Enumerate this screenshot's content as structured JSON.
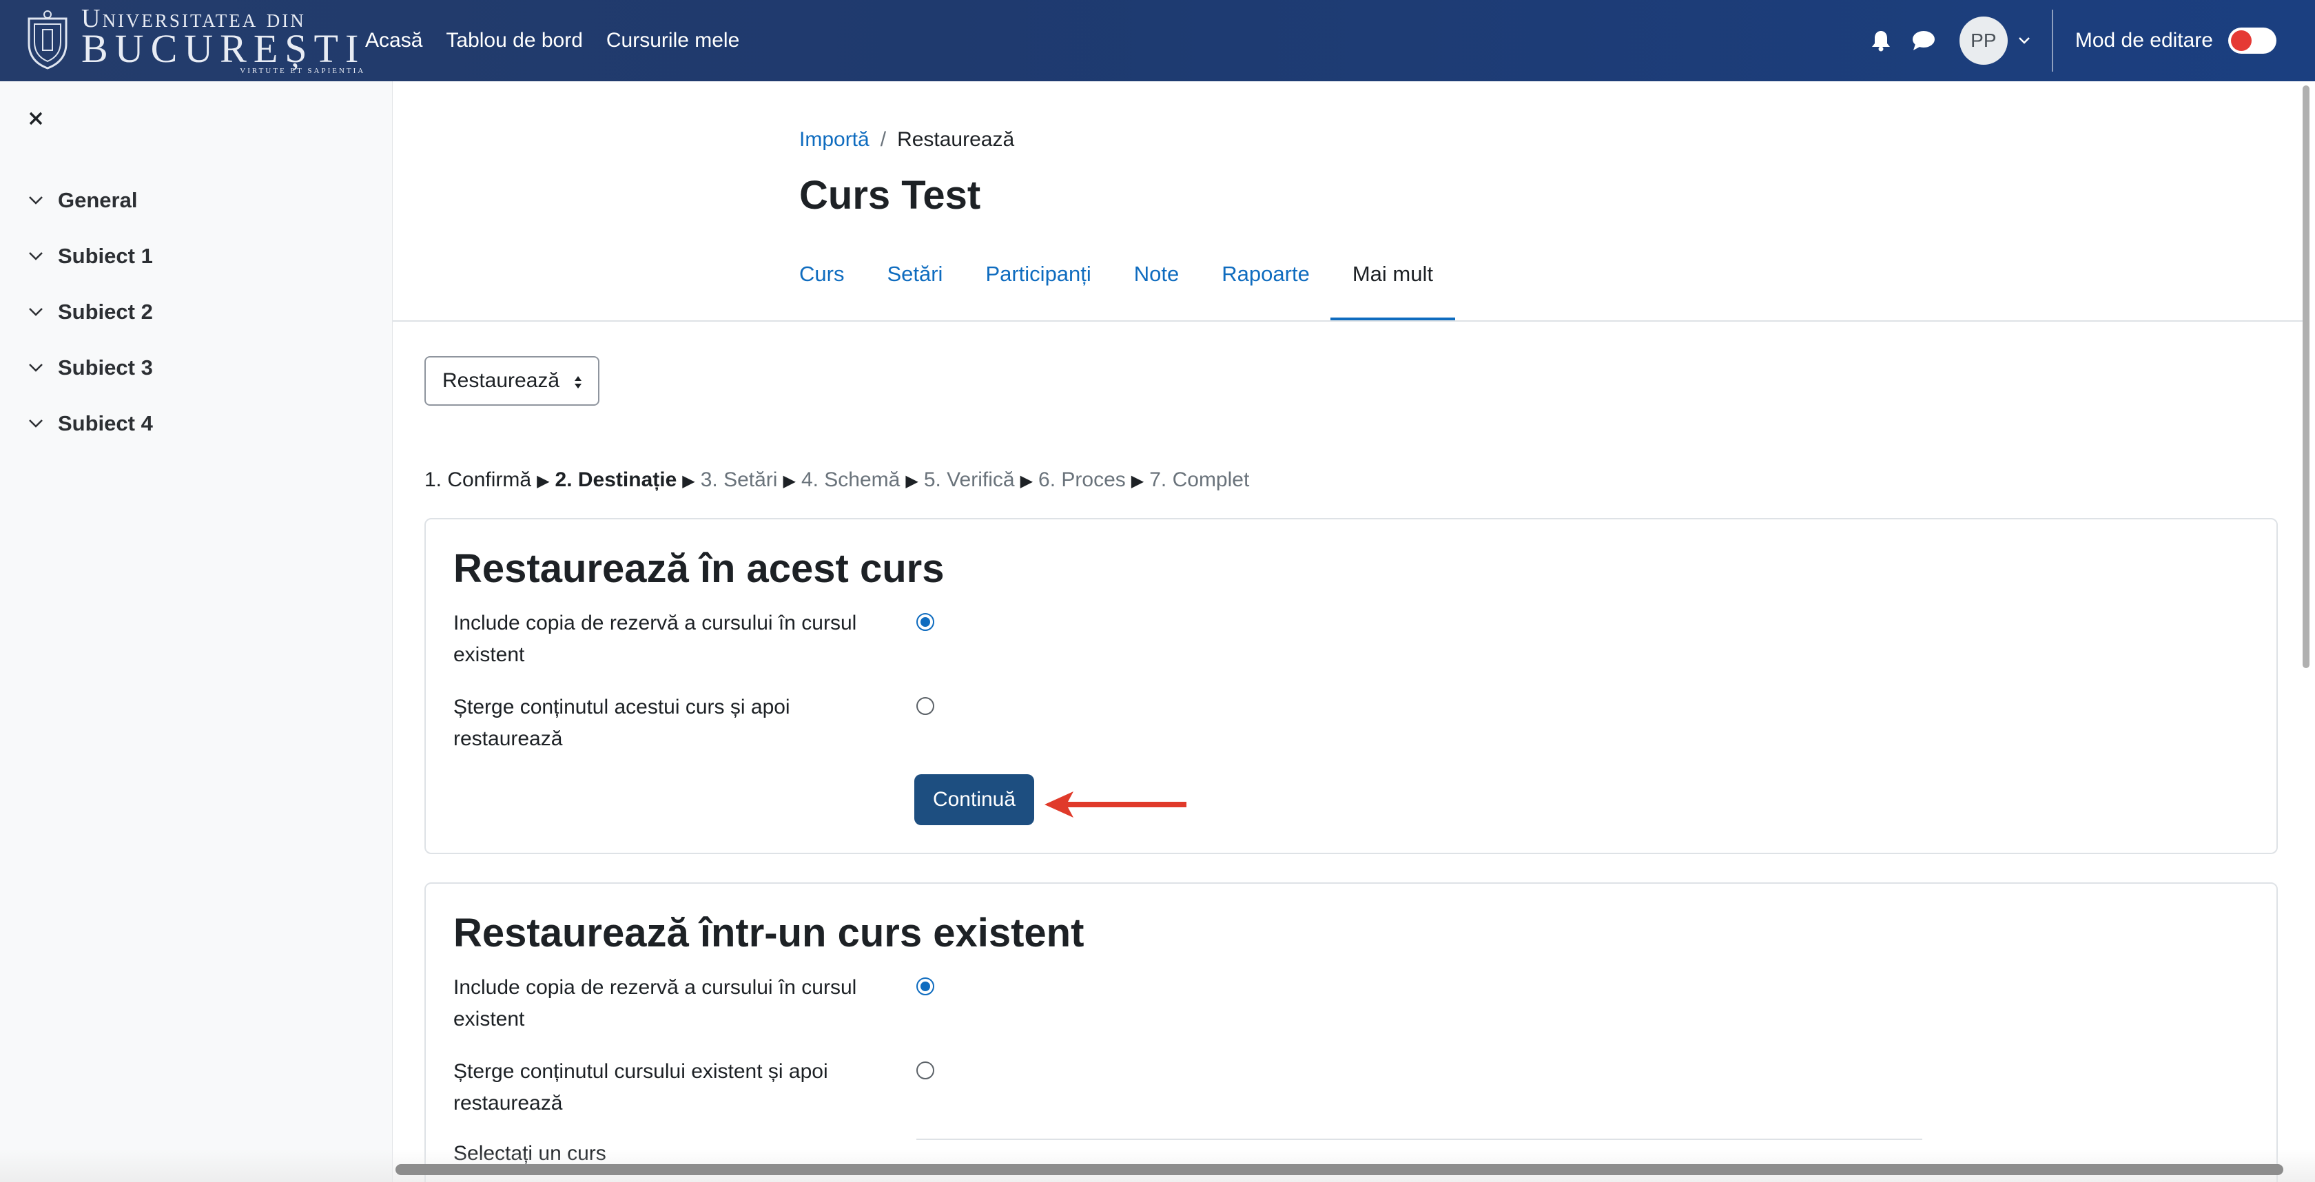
{
  "navbar": {
    "logo": {
      "line1": "Universitatea din",
      "line2": "BUCUREȘTI",
      "line3": "VIRTUTE ET SAPIENTIA"
    },
    "links": [
      "Acasă",
      "Tablou de bord",
      "Cursurile mele"
    ],
    "notifications_icon": "bell-icon",
    "messages_icon": "chat-bubble-icon",
    "user_initials": "PP",
    "edit_mode_label": "Mod de editare",
    "edit_mode_on": false
  },
  "drawer": {
    "close_icon": "close-icon",
    "items": [
      "General",
      "Subiect 1",
      "Subiect 2",
      "Subiect 3",
      "Subiect 4"
    ]
  },
  "breadcrumb": {
    "parent": "Importă",
    "separator": "/",
    "current": "Restaurează"
  },
  "page_title": "Curs Test",
  "secondary_nav": {
    "tabs": [
      "Curs",
      "Setări",
      "Participanți",
      "Note",
      "Rapoarte",
      "Mai mult"
    ],
    "active": "Mai mult"
  },
  "action_select": {
    "selected": "Restaurează"
  },
  "steps": {
    "completed": [
      "1. Confirmă"
    ],
    "current": "2. Destinație",
    "upcoming": [
      "3. Setări",
      "4. Schemă",
      "5. Verifică",
      "6. Proces",
      "7. Complet"
    ],
    "separator": "▶"
  },
  "restore_this_course": {
    "title": "Restaurează în acest curs",
    "options": [
      {
        "label": "Include copia de rezervă a cursului în cursul existent",
        "checked": true
      },
      {
        "label": "Șterge conținutul acestui curs și apoi restaurează",
        "checked": false
      }
    ],
    "continue_label": "Continuă"
  },
  "restore_existing_course": {
    "title": "Restaurează într-un curs existent",
    "options": [
      {
        "label": "Include copia de rezervă a cursului în cursul existent",
        "checked": true
      },
      {
        "label": "Șterge conținutul cursului existent și apoi restaurează",
        "checked": false
      }
    ],
    "select_course_label": "Selectați un curs"
  },
  "colors": {
    "navbar": "#1f3a6e",
    "link": "#0f6cbf",
    "primary_button": "#1d4e80",
    "annotation_arrow": "#e03a2a"
  }
}
